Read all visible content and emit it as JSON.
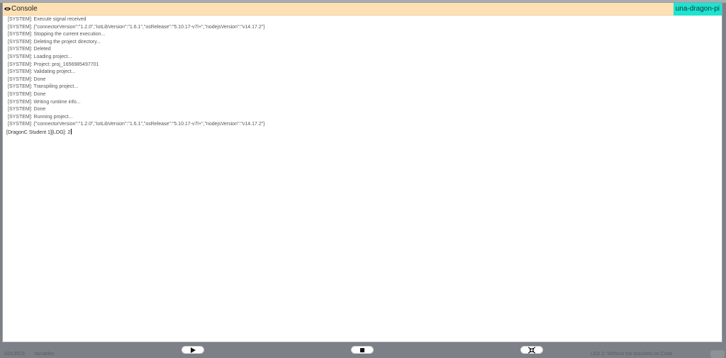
{
  "console": {
    "title": "Console",
    "device_badge": "una-dragon-pi",
    "lines": [
      "[SYSTEM]: Execute signal received",
      "[SYSTEM]: {\"connectorVersion\":\"1.2.0\",\"iotLibVersion\":\"1.6.1\",\"osRelease\":\"5.10.17-v7l+\",\"nodejsVersion\":\"v14.17.2\"}",
      "[SYSTEM]: Stopping the current execution...",
      "[SYSTEM]: Deleting the project directory...",
      "[SYSTEM]: Deleted",
      "[SYSTEM]: Loading project...",
      "[SYSTEM]: Project: proj_1656985497701",
      "[SYSTEM]: Validating project...",
      "[SYSTEM]: Done",
      "[SYSTEM]: Transpiling project...",
      "[SYSTEM]: Done",
      "[SYSTEM]: Writing runtime info...",
      "[SYSTEM]: Done",
      "[SYSTEM]: Running project...",
      "[SYSTEM]: {\"connectorVersion\":\"1.2.0\",\"iotLibVersion\":\"1.6.1\",\"osRelease\":\"5.10.17-v7l+\",\"nodejsVersion\":\"v14.17.2\"}"
    ],
    "user_line": "[DragonC Student 1][LOG]: 2"
  },
  "controls": {
    "play_icon": "play-icon",
    "stop_icon": "stop-icon",
    "collapse_icon": "collapse-arrows-icon"
  },
  "footer": {
    "left_text_1": "SOURCE",
    "left_text_2": "Variables",
    "right_text": "LED 2: Without the brackets on Code"
  },
  "colors": {
    "header_bg": "#fde1b5",
    "badge_bg": "#1de3d0",
    "frame_bg": "#7d8187"
  }
}
